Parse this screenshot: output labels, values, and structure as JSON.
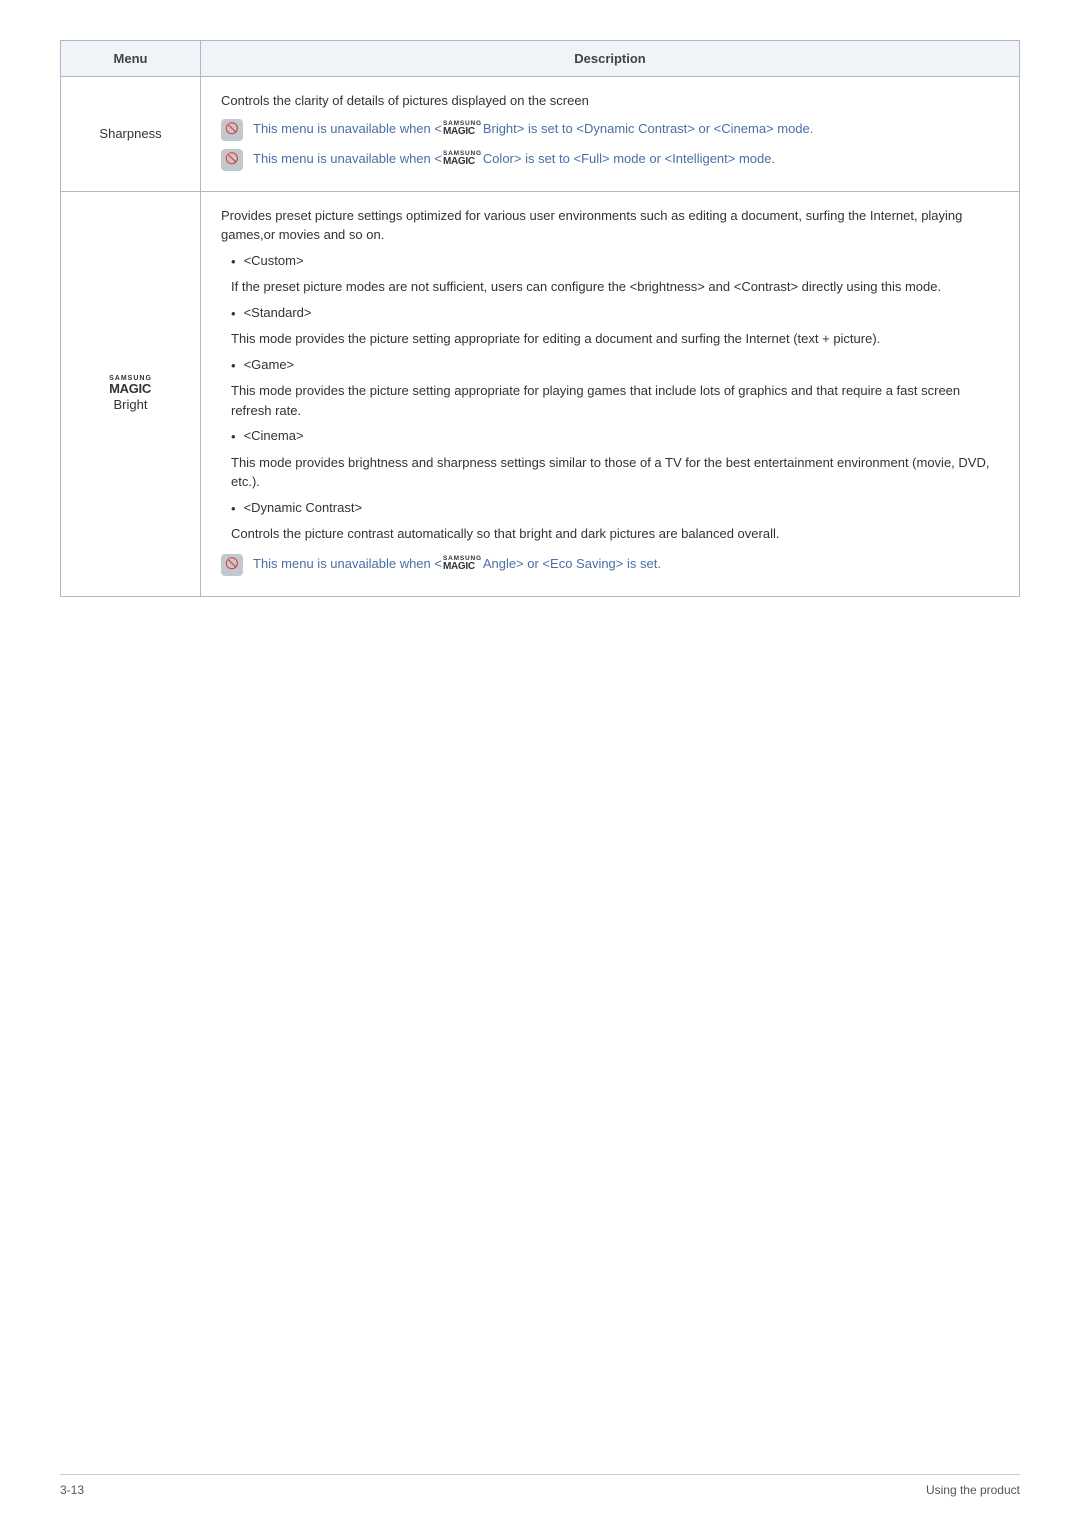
{
  "header": {
    "menu_col": "Menu",
    "desc_col": "Description"
  },
  "rows": [
    {
      "menu": "Sharpness",
      "menu_type": "text",
      "description": {
        "intro": "Controls the clarity of details of pictures displayed on the screen",
        "warnings": [
          {
            "text_before": "This menu is unavailable when <",
            "magic_label": "Bright",
            "text_after": "> is set to <Dynamic Contrast> or <Cinema> mode."
          },
          {
            "text_before": "This menu is unavailable when <",
            "magic_label": "Color",
            "text_after": "> is set to <Full> mode or <Intelligent> mode."
          }
        ]
      }
    },
    {
      "menu": "Bright",
      "menu_type": "magic",
      "description": {
        "intro": "Provides preset picture settings optimized for various user environments such as editing a document, surfing the Internet, playing games,or movies and so on.",
        "bullets": [
          {
            "label": "<Custom>"
          },
          {
            "body": "If the preset picture modes are not sufficient, users can configure the <brightness> and <Contrast> directly using this mode."
          },
          {
            "label": "<Standard>"
          },
          {
            "body": "This mode provides the picture setting appropriate for editing a document and surfing the Internet (text + picture)."
          },
          {
            "label": "<Game>"
          },
          {
            "body": "This mode provides the picture setting appropriate for playing games that include lots of graphics and that require a fast screen refresh rate."
          },
          {
            "label": "<Cinema>"
          },
          {
            "body": "This mode provides brightness and sharpness settings similar to those of a TV for the best entertainment environment (movie, DVD, etc.)."
          },
          {
            "label": "<Dynamic Contrast>"
          },
          {
            "body": "Controls the picture contrast automatically so that bright and dark pictures are balanced overall."
          }
        ],
        "warning": {
          "text_before": "This menu is unavailable when <",
          "magic_label": "Angle",
          "text_after": "> or <Eco Saving> is set."
        }
      }
    }
  ],
  "footer": {
    "page_num": "3-13",
    "page_label": "Using the product"
  }
}
